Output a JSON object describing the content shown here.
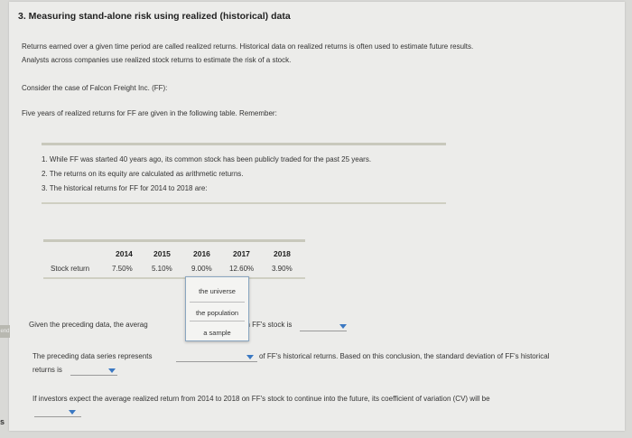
{
  "section": {
    "title": "3. Measuring stand-alone risk using realized (historical) data"
  },
  "intro": {
    "line1": "Returns earned over a given time period are called realized returns. Historical data on realized returns is often used to estimate future results.",
    "line2": "Analysts across companies use realized stock returns to estimate the risk of a stock."
  },
  "case": {
    "line": "Consider the case of Falcon Freight Inc. (FF):",
    "five_years": "Five years of realized returns for FF are given in the following table. Remember:"
  },
  "remember": {
    "items": [
      "1. While FF was started 40 years ago, its common stock has been publicly traded for the past 25 years.",
      "2. The returns on its equity are calculated as arithmetic returns.",
      "3. The historical returns for FF for 2014 to 2018 are:"
    ]
  },
  "returns_table": {
    "years": [
      "2014",
      "2015",
      "2016",
      "2017",
      "2018"
    ],
    "row_label": "Stock return",
    "values": [
      "7.50%",
      "5.10%",
      "9.00%",
      "12.60%",
      "3.90%"
    ]
  },
  "dropdown_menu": {
    "options": [
      "the universe",
      "the population",
      "a sample"
    ]
  },
  "q1": {
    "prefix": "Given the preceding data, the averag",
    "suffix": "on FF's stock is"
  },
  "q2": {
    "prefix": "The preceding data series represents",
    "suffix": "of FF's historical returns. Based on this conclusion, the standard deviation of FF's historical",
    "line2": "returns is"
  },
  "q3": {
    "line": "If investors expect the average realized return from 2014 to 2018 on FF's stock to continue into the future, its coefficient of variation (CV) will be"
  },
  "side": {
    "tab_text": "end",
    "left_letter": "s"
  }
}
